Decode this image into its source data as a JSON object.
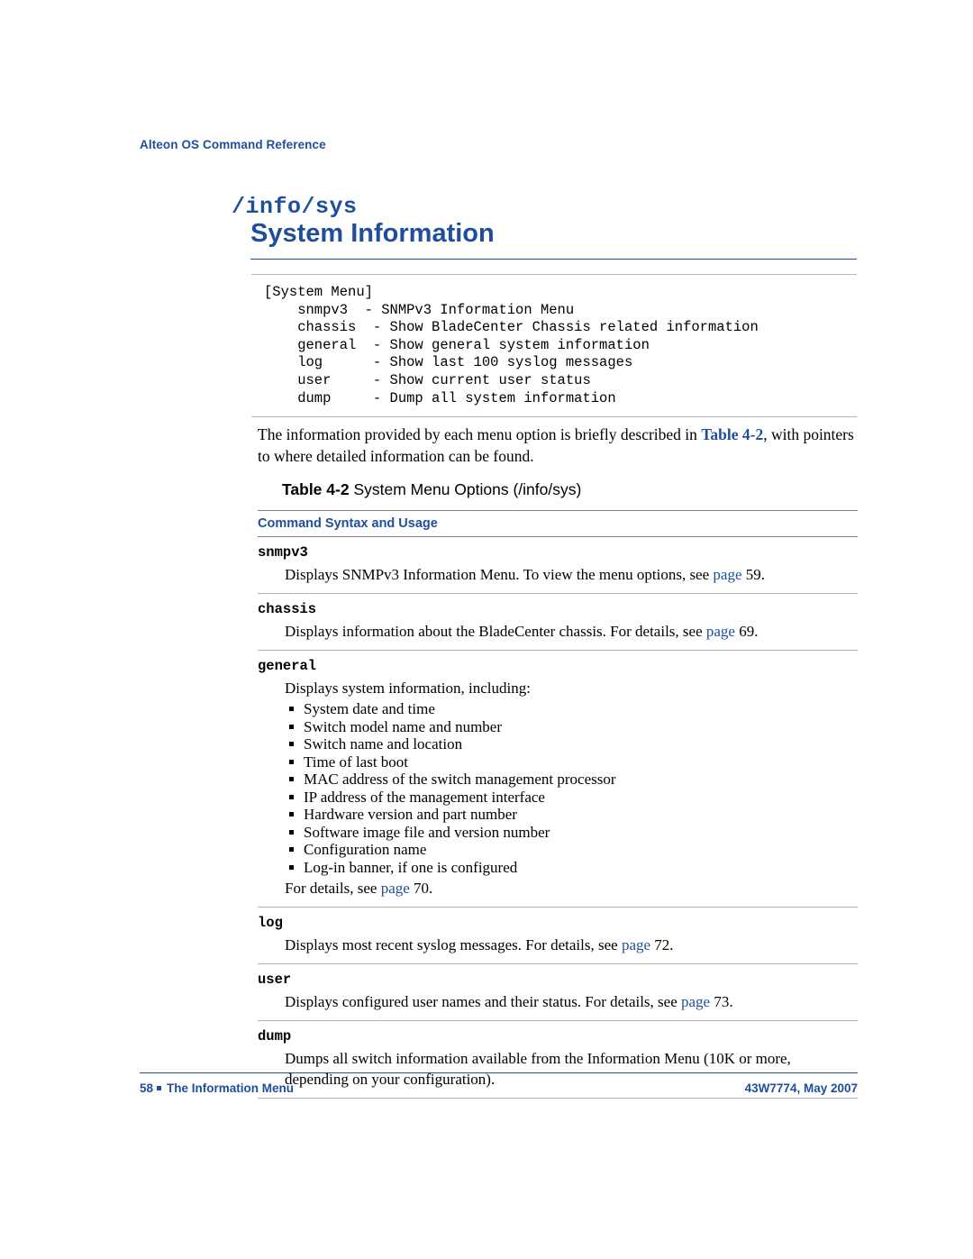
{
  "header": {
    "running_head": "Alteon OS Command Reference"
  },
  "title": {
    "command_path": "/info/sys",
    "heading": "System Information"
  },
  "code_block": {
    "lines": [
      "[System Menu]",
      "    snmpv3  - SNMPv3 Information Menu",
      "    chassis  - Show BladeCenter Chassis related information",
      "    general  - Show general system information",
      "    log      - Show last 100 syslog messages",
      "    user     - Show current user status",
      "    dump     - Dump all system information"
    ]
  },
  "intro": {
    "text_before": "The information provided by each menu option is briefly described in ",
    "xref": "Table 4-2",
    "text_after": ", with pointers to where detailed information can be found."
  },
  "table": {
    "caption_label": "Table 4-2",
    "caption_text": " System Menu Options (/info/sys)",
    "header": "Command Syntax and Usage",
    "rows": [
      {
        "command": "snmpv3",
        "desc_before": "Displays SNMPv3 Information Menu. To view the menu options, see ",
        "link": "page",
        "desc_after": " 59."
      },
      {
        "command": "chassis",
        "desc_before": "Displays information about the BladeCenter chassis. For details, see ",
        "link": "page",
        "desc_after": " 69."
      },
      {
        "command": "general",
        "desc_before": "Displays system information, including:",
        "bullets": [
          "System date and time",
          "Switch model name and number",
          "Switch name and location",
          "Time of last boot",
          "MAC address of the switch management processor",
          "IP address of the management interface",
          "Hardware version and part number",
          "Software image file and version number",
          "Configuration name",
          "Log-in banner, if one is configured"
        ],
        "after_before": "For details, see ",
        "link": "page",
        "after_after": " 70."
      },
      {
        "command": "log",
        "desc_before": "Displays most recent syslog messages. For details, see ",
        "link": "page",
        "desc_after": " 72."
      },
      {
        "command": "user",
        "desc_before": "Displays configured user names and their status. For details, see ",
        "link": "page",
        "desc_after": " 73."
      },
      {
        "command": "dump",
        "desc_before": "Dumps all switch information available from the Information Menu (10K or more, depending on your configuration).",
        "link": "",
        "desc_after": ""
      }
    ]
  },
  "footer": {
    "page_number": "58",
    "chapter": "The Information Menu",
    "doc_id": "43W7774, May 2007"
  },
  "colors": {
    "accent": "#1F4E9C",
    "rule": "#B0B0B0"
  }
}
